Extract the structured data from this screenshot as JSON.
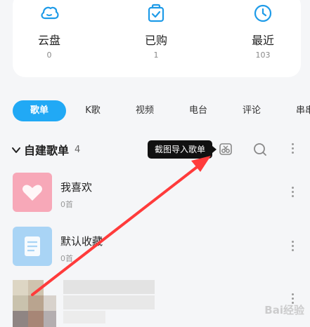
{
  "stats": [
    {
      "label": "云盘",
      "count": "0",
      "icon": "cloud-icon"
    },
    {
      "label": "已购",
      "count": "1",
      "icon": "purchased-bag-icon"
    },
    {
      "label": "最近",
      "count": "103",
      "icon": "clock-icon"
    }
  ],
  "tabs": [
    "歌单",
    "K歌",
    "视频",
    "电台",
    "评论",
    "串串"
  ],
  "section": {
    "title": "自建歌单",
    "count": "4"
  },
  "tooltip": "截图导入歌单",
  "playlists": [
    {
      "name": "我喜欢",
      "count": "0首",
      "cover_color": "#f7a8b8"
    },
    {
      "name": "默认收藏",
      "count": "0首",
      "cover_color": "#a9d4f5"
    }
  ],
  "colors": {
    "accent": "#21a9f5",
    "arrow": "#ff3b3b",
    "icon": "#1e9be8"
  },
  "watermark": "Bai经验"
}
